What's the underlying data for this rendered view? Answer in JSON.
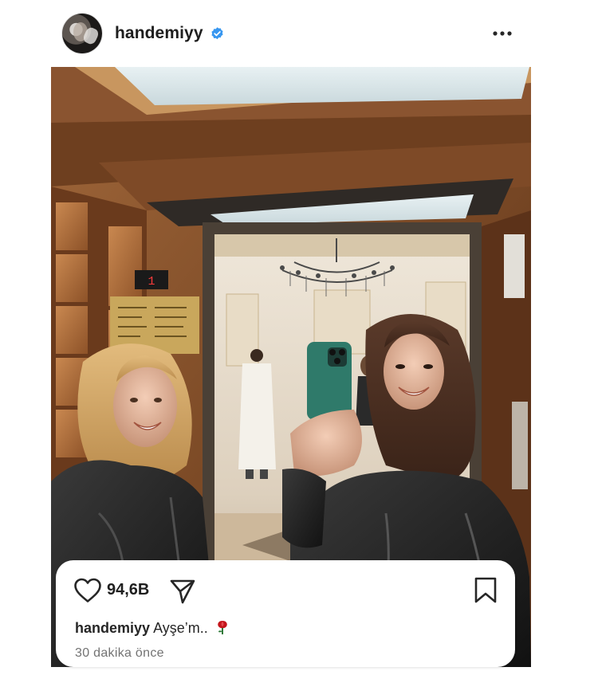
{
  "post": {
    "username": "handemiyy",
    "verified": true,
    "photo_alt": "",
    "likes_count": "94,6B",
    "caption_user": "handemiyy",
    "caption_text": "Ayşe’m..",
    "caption_emoji": "rose",
    "timestamp": "30 dakika önce",
    "elevator_floor_display": "1"
  },
  "icons": {
    "verified": "verified-badge-icon",
    "more": "more-options-icon",
    "like": "heart-icon",
    "share": "paper-plane-icon",
    "save": "bookmark-icon"
  },
  "colors": {
    "verified_blue": "#3897f0",
    "text_primary": "#262626",
    "text_secondary": "#737373",
    "emoji_rose": "#c4161c"
  }
}
